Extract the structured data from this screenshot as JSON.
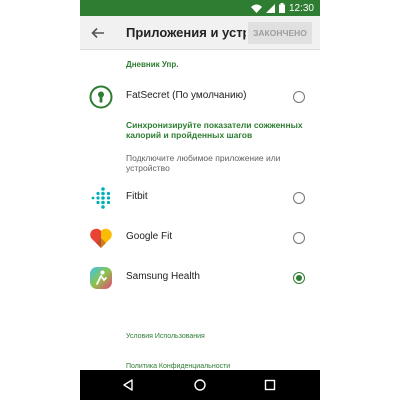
{
  "status_bar": {
    "time": "12:30",
    "icons": [
      "wifi-icon",
      "signal-icon",
      "battery-icon"
    ]
  },
  "app_bar": {
    "title": "Приложения и устройства",
    "done_label": "ЗАКОНЧЕНО",
    "back_icon": "arrow-back-icon"
  },
  "diary_section": {
    "label": "Дневник Упр.",
    "option": {
      "name": "FatSecret (По умолчанию)",
      "icon": "fatsecret-keyhole-icon",
      "selected": false
    }
  },
  "sync_section": {
    "title": "Синхронизируйте показатели сожженных калорий и пройденных шагов",
    "description": "Подключите любимое приложение или устройство",
    "options": [
      {
        "name": "Fitbit",
        "icon": "fitbit-icon",
        "selected": false
      },
      {
        "name": "Google Fit",
        "icon": "google-fit-icon",
        "selected": false
      },
      {
        "name": "Samsung Health",
        "icon": "samsung-health-icon",
        "selected": true
      }
    ]
  },
  "links": {
    "terms": "Условия Использования",
    "privacy": "Политика Конфиденциальности"
  },
  "colors": {
    "accent": "#2e7d32",
    "status_bar": "#2e7d32",
    "app_bar": "#f1f1f1",
    "nav_bar": "#000000"
  },
  "nav_bar": {
    "buttons": [
      "back-triangle-icon",
      "home-circle-icon",
      "recents-square-icon"
    ]
  }
}
